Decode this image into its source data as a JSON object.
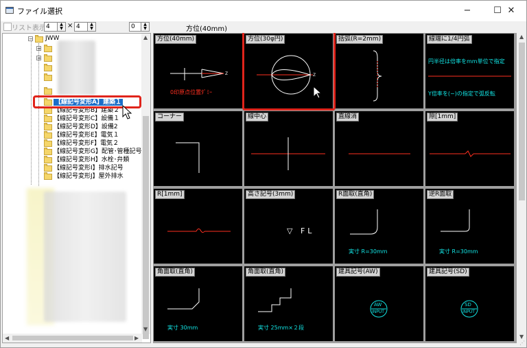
{
  "window": {
    "title": "ファイル選択",
    "minimize": "−",
    "maximize": "☐",
    "close": "✕"
  },
  "toolbar": {
    "list_display_label": "リスト表示",
    "cols_value": "4",
    "times_symbol": "×",
    "rows_value": "4",
    "zero_value": "0",
    "current_path_label": "方位(40mm)"
  },
  "tree": {
    "root_label": "JWW",
    "items": [
      "【線記号変形A】建築１",
      "【線記号変形B】建築２",
      "【線記号変形C】設備１",
      "【線記号変形D】設備2",
      "【線記号変形E】電気１",
      "【線記号変形F】電気２",
      "【線記号変形G】配管･管種記号",
      "【線記号変形H】水栓･弁類",
      "【線記号変形I】排水記号",
      "【線記号変形J】屋外排水"
    ],
    "selected_index": 0
  },
  "cells": [
    {
      "label": "方位(40mm)",
      "texts": [
        "0印原点位置ﾀﾞﾐｰ"
      ]
    },
    {
      "label": "方位(30φ円)",
      "texts": []
    },
    {
      "label": "括弧(R=2mm)",
      "texts": []
    },
    {
      "label": "線端に1/4円弧",
      "texts": [
        "円半径は倍率をmm単位で指定",
        "Y倍率を(−)の指定で弧反転"
      ]
    },
    {
      "label": "コーナー",
      "texts": []
    },
    {
      "label": "線中心",
      "texts": []
    },
    {
      "label": "直線消",
      "texts": []
    },
    {
      "label": "隙[1mm]",
      "texts": []
    },
    {
      "label": "R[1mm]",
      "texts": []
    },
    {
      "label": "高さ記号(3mm)",
      "texts": [
        "▽ FL"
      ]
    },
    {
      "label": "R面取(直角)",
      "texts": [
        "実寸 R=30mm"
      ]
    },
    {
      "label": "逆R面取",
      "texts": [
        "実寸 R=30mm"
      ]
    },
    {
      "label": "角面取(直角)",
      "texts": [
        "実寸 30mm"
      ]
    },
    {
      "label": "角面取(直角)",
      "texts": [
        "実寸 25mm×２段"
      ]
    },
    {
      "label": "建具記号(AW)",
      "texts": [
        "AW",
        "INPUT"
      ]
    },
    {
      "label": "建具記号(SD)",
      "texts": [
        "SD",
        "INPUT"
      ]
    }
  ],
  "colors": {
    "accent_red": "#e0241b",
    "selection_blue": "#1b6ec9",
    "cyan_text": "#12e6e6"
  }
}
